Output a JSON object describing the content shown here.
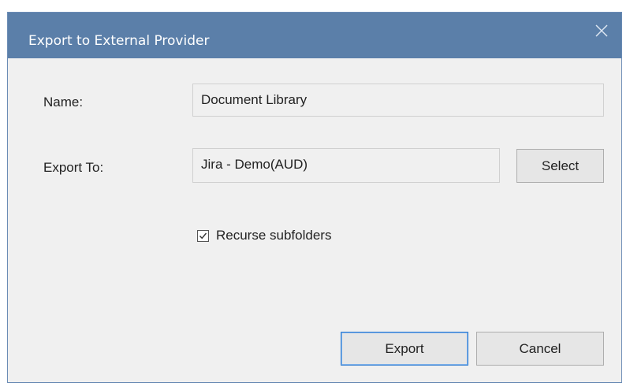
{
  "window": {
    "title": "Export to External Provider",
    "close_icon": "close-icon"
  },
  "form": {
    "name_label": "Name:",
    "name_value": "Document Library",
    "export_to_label": "Export To:",
    "export_to_value": "Jira - Demo(AUD)",
    "select_button": "Select",
    "recurse": {
      "label": "Recurse subfolders",
      "checked": true
    }
  },
  "footer": {
    "export_button": "Export",
    "cancel_button": "Cancel"
  },
  "colors": {
    "titlebar": "#5b7fa9",
    "dialog_bg": "#f0f0f0",
    "default_button_border": "#2f7bd0"
  }
}
